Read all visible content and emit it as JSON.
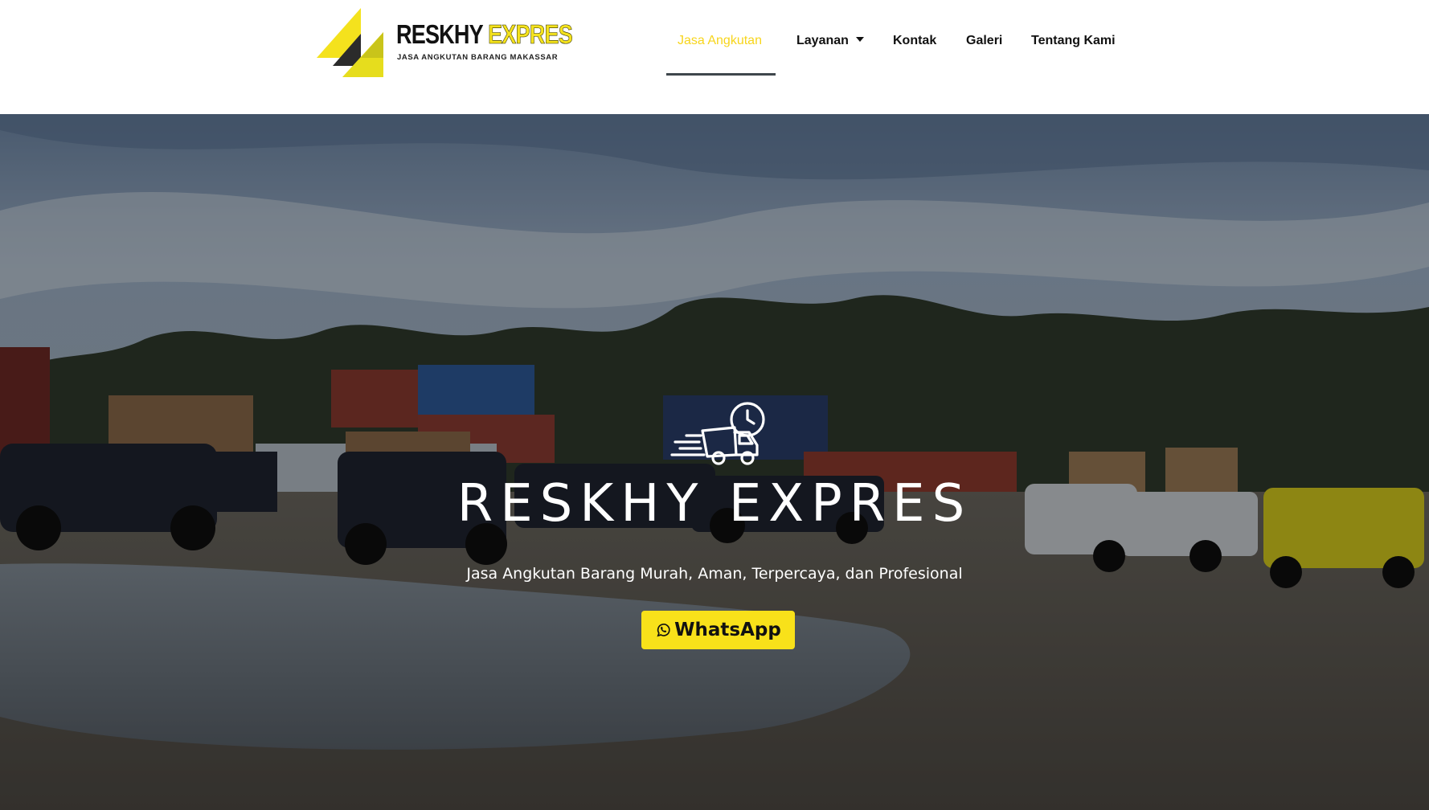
{
  "brand": {
    "word1": "RESKHY",
    "word2": "EXPRES",
    "tagline": "JASA ANGKUTAN BARANG MAKASSAR",
    "colors": {
      "yellow": "#f4e21d",
      "dark": "#2b2b2b",
      "accent_olive": "#c9c41a"
    }
  },
  "nav": {
    "items": [
      {
        "label": "Jasa Angkutan",
        "active": true
      },
      {
        "label": "Layanan",
        "has_dropdown": true
      },
      {
        "label": "Kontak"
      },
      {
        "label": "Galeri"
      },
      {
        "label": "Tentang Kami"
      }
    ],
    "active_color": "#f7d51c",
    "underline_color": "#3f464c"
  },
  "hero": {
    "icon": "delivery-truck-clock-icon",
    "title": "RESKHY EXPRES",
    "subtitle": "Jasa Angkutan Barang Murah, Aman, Terpercaya, dan Profesional",
    "cta": {
      "label": "WhatsApp",
      "icon": "whatsapp-icon",
      "color": "#f8e11a"
    },
    "background": "photo-of-pickup-trucks-at-container-yard"
  }
}
